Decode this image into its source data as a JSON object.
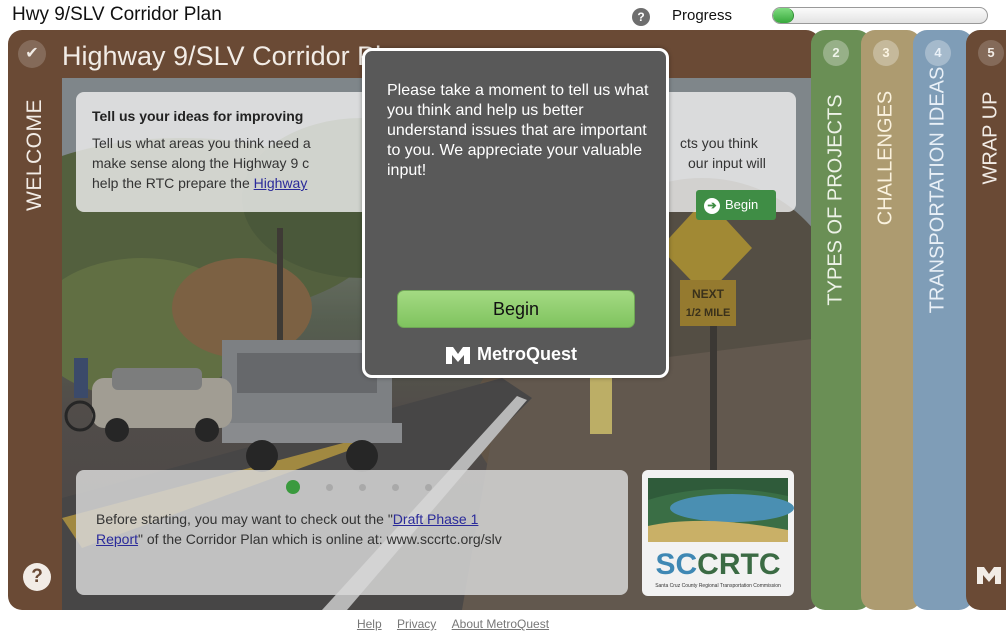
{
  "app_title": "Hwy 9/SLV Corridor Plan",
  "progress": {
    "label": "Progress",
    "help_icon": "question-icon",
    "fraction": 0.1
  },
  "main": {
    "title": "Highway 9/SLV Corridor Pl",
    "check_icon": "check-icon",
    "welcome_label": "WELCOME",
    "info": {
      "heading": "Tell us your ideas for improving",
      "line1_left": "Tell us what areas you think need a",
      "line1_right": "cts you think",
      "line2_left": "make sense along the Highway 9 c",
      "line2_right": "our input will",
      "line3_prefix": "help the RTC prepare the ",
      "line3_link": "Highway",
      "begin_label": "Begin"
    },
    "carousel_dots": 5,
    "carousel_active": 0,
    "bottom": {
      "line1_prefix": "Before starting, you may want to check out the \"",
      "line1_link": "Draft Phase 1",
      "line2_link": "Report",
      "line2_suffix": "\" of the Corridor Plan which is online at: www.sccrtc.org/slv"
    },
    "logo": {
      "text": "SCCRTC",
      "subtext": "Santa Cruz County Regional Transportation Commission"
    },
    "road_signs": {
      "next": "NEXT",
      "mile": "1/2 MILE"
    },
    "help_icon": "question-icon"
  },
  "tabs": [
    {
      "number": "2",
      "label": "TYPES OF PROJECTS"
    },
    {
      "number": "3",
      "label": "CHALLENGES"
    },
    {
      "number": "4",
      "label": "TRANSPORTATION IDEAS"
    },
    {
      "number": "5",
      "label": "WRAP UP"
    }
  ],
  "modal": {
    "text": "Please take a moment to tell us what you think and help us better understand issues that are important to you. We appreciate your valuable input!",
    "begin_label": "Begin",
    "brand": "MetroQuest"
  },
  "footer": {
    "links": [
      "Help",
      "Privacy",
      "About MetroQuest"
    ]
  },
  "colors": {
    "welcome_brown": "#6a4a35",
    "types_green": "#6a8f55",
    "challenges_tan": "#ad9b70",
    "ideas_blue": "#7f9db7",
    "begin_green": "#8fcf6f",
    "progress_green": "#4cb84f"
  }
}
